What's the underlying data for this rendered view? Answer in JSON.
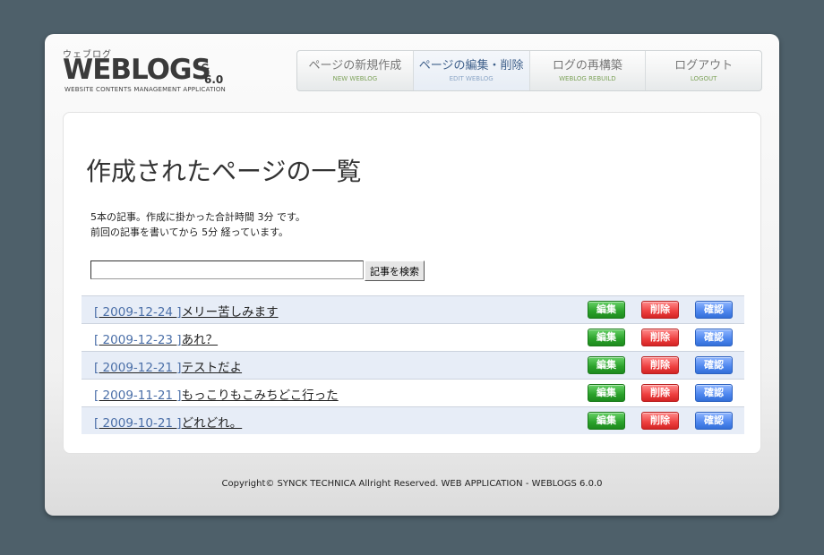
{
  "logo": {
    "kana": "ウェブログ",
    "name": "WEBLOGS",
    "version": "6.0",
    "tagline": "WEBSITE CONTENTS MANAGEMENT APPLICATION"
  },
  "nav": {
    "items": [
      {
        "label": "ページの新規作成",
        "sub": "NEW WEBLOG",
        "active": false
      },
      {
        "label": "ページの編集・削除",
        "sub": "EDIT WEBLOG",
        "active": true
      },
      {
        "label": "ログの再構築",
        "sub": "WEBLOG REBUILD",
        "active": false
      },
      {
        "label": "ログアウト",
        "sub": "LOGOUT",
        "active": false
      }
    ]
  },
  "main": {
    "title": "作成されたページの一覧",
    "stats_line1": "5本の記事。作成に掛かった合計時間 3分 です。",
    "stats_line2": "前回の記事を書いてから 5分 経っています。",
    "search": {
      "value": "",
      "button_label": "記事を検索"
    },
    "articles": [
      {
        "date": "[ 2009-12-24 ]",
        "title": "メリー苦しみます"
      },
      {
        "date": "[ 2009-12-23 ]",
        "title": "あれ？"
      },
      {
        "date": "[ 2009-12-21 ]",
        "title": "テストだよ"
      },
      {
        "date": "[ 2009-11-21 ]",
        "title": "もっこりもこみちどこ行った"
      },
      {
        "date": "[ 2009-10-21 ]",
        "title": "どれどれ。"
      }
    ],
    "actions": {
      "edit": "編集",
      "delete": "削除",
      "confirm": "確認"
    }
  },
  "footer": {
    "copyright": "Copyright© SYNCK TECHNICA Allright Reserved. WEB APPLICATION - WEBLOGS 6.0.0"
  },
  "colors": {
    "background": "#4e606a",
    "edit": "#2aa12a",
    "delete": "#ee3f3f",
    "confirm": "#4d86ee",
    "active_nav": "#3e5f8a"
  }
}
